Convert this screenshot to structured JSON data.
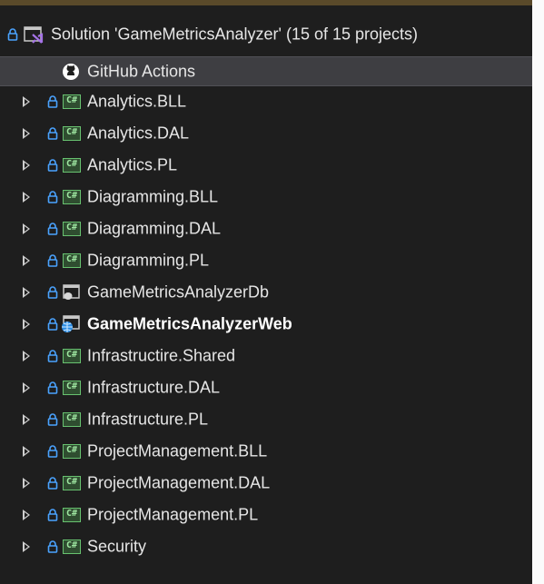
{
  "solution": {
    "label": "Solution 'GameMetricsAnalyzer' (15 of 15 projects)",
    "icon": "visual-studio-solution-icon"
  },
  "github_actions": {
    "label": "GitHub Actions",
    "icon": "github-icon"
  },
  "projects": [
    {
      "label": "Analytics.BLL",
      "icon": "csharp-project-icon"
    },
    {
      "label": "Analytics.DAL",
      "icon": "csharp-project-icon"
    },
    {
      "label": "Analytics.PL",
      "icon": "csharp-project-icon"
    },
    {
      "label": "Diagramming.BLL",
      "icon": "csharp-project-icon"
    },
    {
      "label": "Diagramming.DAL",
      "icon": "csharp-project-icon"
    },
    {
      "label": "Diagramming.PL",
      "icon": "csharp-project-icon"
    },
    {
      "label": "GameMetricsAnalyzerDb",
      "icon": "database-project-icon"
    },
    {
      "label": "GameMetricsAnalyzerWeb",
      "icon": "web-project-icon",
      "bold": true
    },
    {
      "label": "Infrastructire.Shared",
      "icon": "csharp-project-icon"
    },
    {
      "label": "Infrastructure.DAL",
      "icon": "csharp-project-icon"
    },
    {
      "label": "Infrastructure.PL",
      "icon": "csharp-project-icon"
    },
    {
      "label": "ProjectManagement.BLL",
      "icon": "csharp-project-icon"
    },
    {
      "label": "ProjectManagement.DAL",
      "icon": "csharp-project-icon"
    },
    {
      "label": "ProjectManagement.PL",
      "icon": "csharp-project-icon"
    },
    {
      "label": "Security",
      "icon": "csharp-project-icon"
    }
  ],
  "csharp_icon_text": "C#",
  "colors": {
    "background": "#1e1e1e",
    "selected_row": "#3e3e42",
    "text": "#e6e6e6",
    "lock": "#4aa3ff",
    "csharp_icon": "#68c270"
  }
}
